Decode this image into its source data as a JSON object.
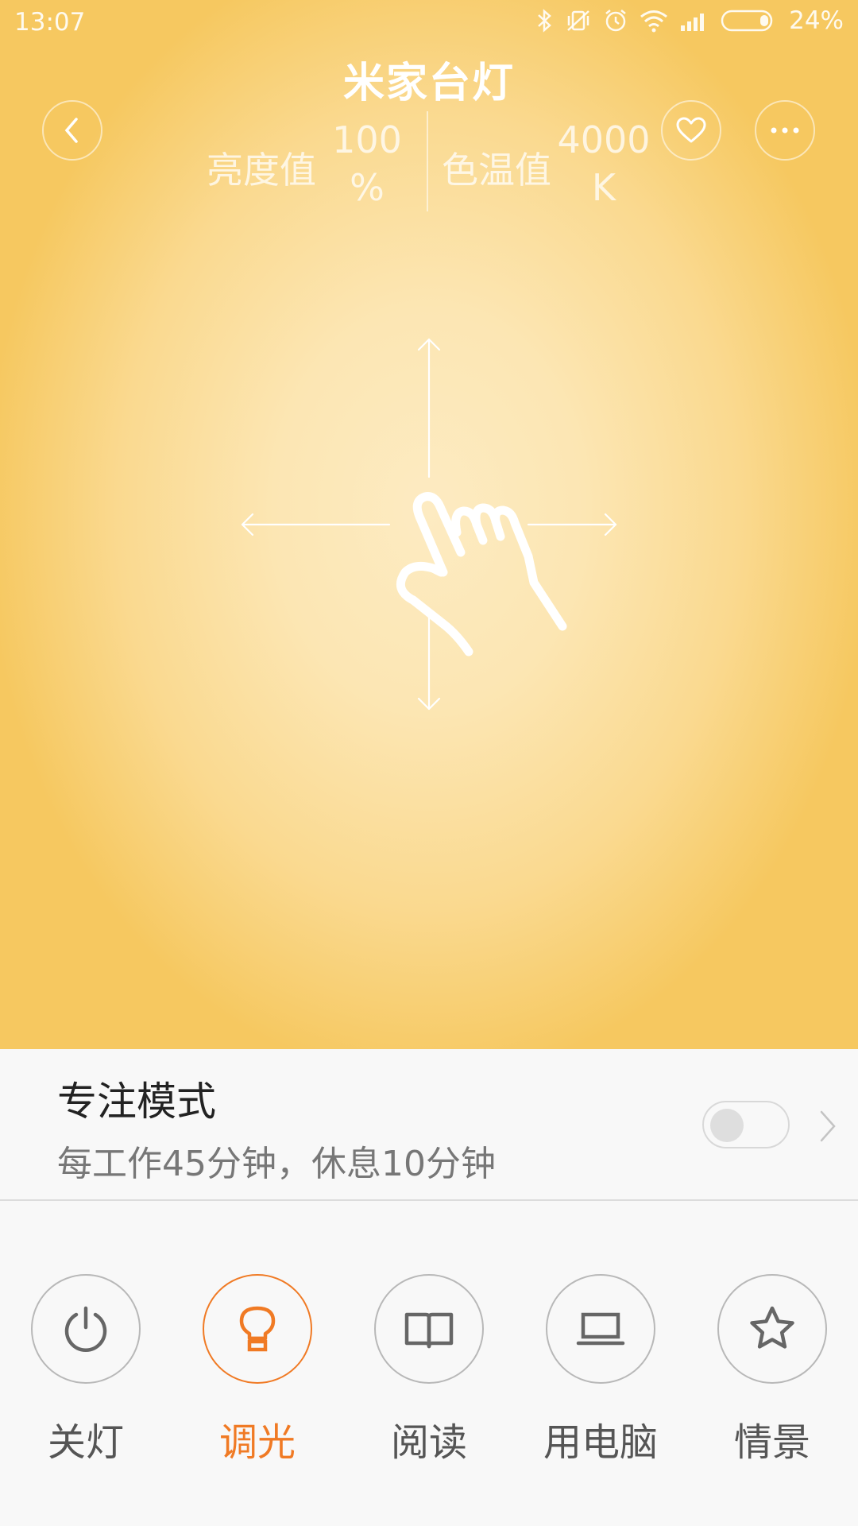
{
  "status_bar": {
    "time": "13:07",
    "battery": "24%"
  },
  "header": {
    "title": "米家台灯"
  },
  "metrics": {
    "brightness_label": "亮度值",
    "brightness_value": "100\n%",
    "color_temp_label": "色温值",
    "color_temp_value": "4000\nK"
  },
  "focus_mode": {
    "title": "专注模式",
    "subtitle": "每工作45分钟，休息10分钟",
    "enabled": false
  },
  "modes": [
    {
      "label": "关灯",
      "icon": "power-icon",
      "active": false
    },
    {
      "label": "调光",
      "icon": "bulb-icon",
      "active": true
    },
    {
      "label": "阅读",
      "icon": "book-icon",
      "active": false
    },
    {
      "label": "用电脑",
      "icon": "laptop-icon",
      "active": false
    },
    {
      "label": "情景",
      "icon": "star-icon",
      "active": false
    }
  ],
  "colors": {
    "accent": "#f07a24",
    "lamp_glow": "#fad98f"
  }
}
